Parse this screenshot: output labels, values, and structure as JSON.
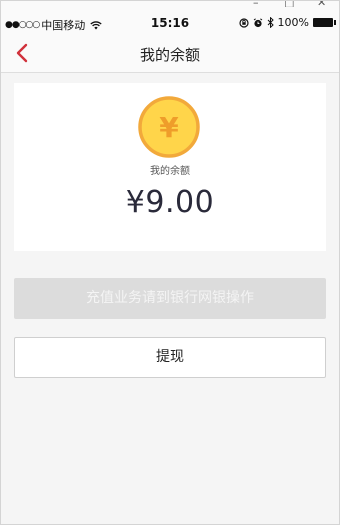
{
  "window": {
    "minimize_glyph": "–",
    "maximize_glyph": "□",
    "close_glyph": "✕"
  },
  "status_bar": {
    "signal_dots": "●●○○○",
    "carrier": "中国移动",
    "time": "15:16",
    "battery_percent": "100%",
    "icons": [
      "wifi-icon",
      "orientation-lock-icon",
      "alarm-icon",
      "bluetooth-icon",
      "battery-icon"
    ]
  },
  "nav": {
    "title": "我的余额",
    "back_icon": "chevron-left-icon"
  },
  "balance": {
    "coin_symbol": "¥",
    "label": "我的余额",
    "amount": "¥9.00"
  },
  "actions": {
    "recharge_label": "充值业务请到银行网银操作",
    "withdraw_label": "提现"
  },
  "colors": {
    "accent_red": "#d0313b",
    "coin_fill": "#ffd54a",
    "coin_border": "#f2a93b",
    "disabled_button": "#dcdcdc"
  }
}
